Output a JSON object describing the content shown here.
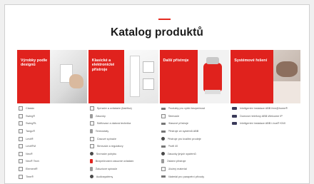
{
  "page": {
    "title": "Katalog produktů"
  },
  "banners": [
    {
      "label": "Výrobky podle designů"
    },
    {
      "label": "Klasické a elektronické přístroje"
    },
    {
      "label": "Další přístroje"
    },
    {
      "label": "Systémové řešení"
    }
  ],
  "columns": [
    {
      "items": [
        {
          "text": "Classic",
          "icon": "frame-icon"
        },
        {
          "text": "Swing®",
          "icon": "frame-icon"
        },
        {
          "text": "Swing®L",
          "icon": "frame-icon"
        },
        {
          "text": "Tango®",
          "icon": "frame-icon"
        },
        {
          "text": "Levit®",
          "icon": "frame-icon"
        },
        {
          "text": "Levit®M",
          "icon": "frame-icon"
        },
        {
          "text": "Neo®",
          "icon": "frame-icon"
        },
        {
          "text": "Neo® Tech",
          "icon": "frame-icon"
        },
        {
          "text": "Element®",
          "icon": "frame-icon"
        },
        {
          "text": "Time®",
          "icon": "frame-icon"
        }
      ]
    },
    {
      "items": [
        {
          "text": "Spínače a ovládače (tlačítka)",
          "icon": "switch-icon"
        },
        {
          "text": "Zásuvky",
          "icon": "socket-icon"
        },
        {
          "text": "Sdělovací a datová technika",
          "icon": "data-icon"
        },
        {
          "text": "Termostaty",
          "icon": "thermostat-icon"
        },
        {
          "text": "Časové spínače",
          "icon": "timer-icon"
        },
        {
          "text": "Stmívače a regulátory",
          "icon": "dimmer-icon"
        },
        {
          "text": "Snímače pohybu",
          "icon": "motion-sensor-icon"
        },
        {
          "text": "Bezpečnostní zásuvné ovládání",
          "icon": "safety-icon"
        },
        {
          "text": "Žaluziové spínače",
          "icon": "blind-icon"
        },
        {
          "text": "Audiosystémy",
          "icon": "audio-icon"
        }
      ]
    },
    {
      "items": [
        {
          "text": "Produkty pro vyšší bezpečnost",
          "icon": "shield-icon"
        },
        {
          "text": "Stmívače",
          "icon": "dimmer-icon"
        },
        {
          "text": "Hlasové přístroje",
          "icon": "speaker-icon"
        },
        {
          "text": "Přístroje ze systémů ABB",
          "icon": "device-icon"
        },
        {
          "text": "Přístroje pro kvalitní prodeje",
          "icon": "device-icon"
        },
        {
          "text": "Profil 45",
          "icon": "profile-icon"
        },
        {
          "text": "Zásuvky jiných systémů",
          "icon": "socket-icon"
        },
        {
          "text": "Ostatní přístroje",
          "icon": "device-icon"
        },
        {
          "text": "Úložný materiál",
          "icon": "box-icon"
        },
        {
          "text": "Materiál pro parapetní přívody",
          "icon": "cable-icon"
        }
      ]
    },
    {
      "items": [
        {
          "text": "Inteligentní instalace ABB free@home®",
          "icon": "panel-icon"
        },
        {
          "text": "Domovní telefony ABB-Welcome IP",
          "icon": "intercom-icon"
        },
        {
          "text": "Inteligentní instalace ABB i-bus® KNX",
          "icon": "panel-icon"
        }
      ]
    }
  ]
}
